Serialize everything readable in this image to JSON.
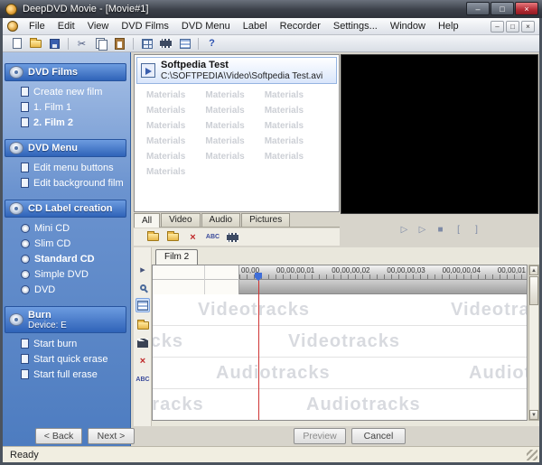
{
  "window": {
    "title": "DeepDVD Movie - [Movie#1]",
    "status_bar": "Ready"
  },
  "menubar": {
    "items": [
      "File",
      "Edit",
      "View",
      "DVD Films",
      "DVD Menu",
      "Label",
      "Recorder",
      "Settings...",
      "Window",
      "Help"
    ]
  },
  "sidebar": {
    "sections": [
      {
        "title": "DVD Films",
        "items": [
          {
            "label": "Create new film",
            "active": false
          },
          {
            "label": "1. Film 1",
            "active": false
          },
          {
            "label": "2. Film 2",
            "active": true
          }
        ]
      },
      {
        "title": "DVD Menu",
        "items": [
          {
            "label": "Edit menu buttons",
            "active": false
          },
          {
            "label": "Edit background film",
            "active": false
          }
        ]
      },
      {
        "title": "CD Label creation",
        "items": [
          {
            "label": "Mini CD",
            "active": false
          },
          {
            "label": "Slim CD",
            "active": false
          },
          {
            "label": "Standard CD",
            "active": true
          },
          {
            "label": "Simple DVD",
            "active": false
          },
          {
            "label": "DVD",
            "active": false
          }
        ]
      },
      {
        "title": "Burn",
        "subtitle": "Device: E",
        "items": [
          {
            "label": "Start burn",
            "active": false
          },
          {
            "label": "Start quick erase",
            "active": false
          },
          {
            "label": "Start full erase",
            "active": false
          }
        ]
      }
    ]
  },
  "materials": {
    "selected": {
      "name": "Softpedia Test",
      "path": "C:\\SOFTPEDIA\\Video\\Softpedia Test.avi"
    },
    "watermark": "Materials",
    "tabs": [
      "All",
      "Video",
      "Audio",
      "Pictures"
    ],
    "abc_label": "ABC"
  },
  "timeline": {
    "film_tab": "Film 2",
    "ruler_labels": [
      "00,00",
      "00,00,00,01",
      "00,00,00,02",
      "00,00,00,03",
      "00,00,00,04",
      "00,00,01"
    ],
    "video_watermark": "Videotracks",
    "audio_watermark": "Audiotracks",
    "abc_label": "ABC"
  },
  "footer": {
    "back": "< Back",
    "next": "Next >",
    "preview": "Preview",
    "cancel": "Cancel"
  },
  "icons": {
    "minimize": "–",
    "maximize": "□",
    "close": "×",
    "mdi_minimize": "–",
    "mdi_restore": "□",
    "mdi_close": "×",
    "help": "?",
    "play": "▷",
    "play_from_cursor": "▷",
    "stop": "■",
    "mark_in": "[",
    "mark_out": "]",
    "pointer": "▸",
    "delete": "×",
    "scroll_up": "▲",
    "scroll_down": "▼"
  }
}
